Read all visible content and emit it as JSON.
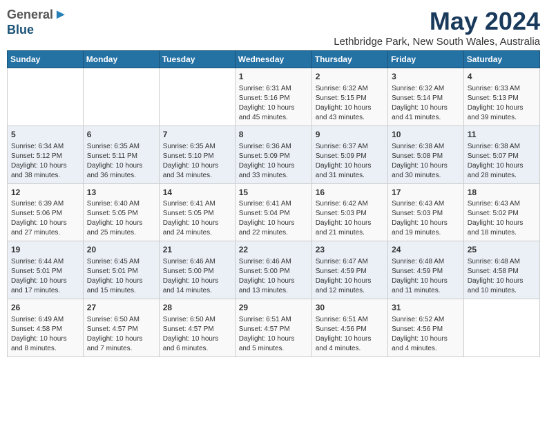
{
  "header": {
    "logo_general": "General",
    "logo_blue": "Blue",
    "month": "May 2024",
    "location": "Lethbridge Park, New South Wales, Australia"
  },
  "weekdays": [
    "Sunday",
    "Monday",
    "Tuesday",
    "Wednesday",
    "Thursday",
    "Friday",
    "Saturday"
  ],
  "weeks": [
    [
      {
        "day": "",
        "sunrise": "",
        "sunset": "",
        "daylight": ""
      },
      {
        "day": "",
        "sunrise": "",
        "sunset": "",
        "daylight": ""
      },
      {
        "day": "",
        "sunrise": "",
        "sunset": "",
        "daylight": ""
      },
      {
        "day": "1",
        "sunrise": "Sunrise: 6:31 AM",
        "sunset": "Sunset: 5:16 PM",
        "daylight": "Daylight: 10 hours and 45 minutes."
      },
      {
        "day": "2",
        "sunrise": "Sunrise: 6:32 AM",
        "sunset": "Sunset: 5:15 PM",
        "daylight": "Daylight: 10 hours and 43 minutes."
      },
      {
        "day": "3",
        "sunrise": "Sunrise: 6:32 AM",
        "sunset": "Sunset: 5:14 PM",
        "daylight": "Daylight: 10 hours and 41 minutes."
      },
      {
        "day": "4",
        "sunrise": "Sunrise: 6:33 AM",
        "sunset": "Sunset: 5:13 PM",
        "daylight": "Daylight: 10 hours and 39 minutes."
      }
    ],
    [
      {
        "day": "5",
        "sunrise": "Sunrise: 6:34 AM",
        "sunset": "Sunset: 5:12 PM",
        "daylight": "Daylight: 10 hours and 38 minutes."
      },
      {
        "day": "6",
        "sunrise": "Sunrise: 6:35 AM",
        "sunset": "Sunset: 5:11 PM",
        "daylight": "Daylight: 10 hours and 36 minutes."
      },
      {
        "day": "7",
        "sunrise": "Sunrise: 6:35 AM",
        "sunset": "Sunset: 5:10 PM",
        "daylight": "Daylight: 10 hours and 34 minutes."
      },
      {
        "day": "8",
        "sunrise": "Sunrise: 6:36 AM",
        "sunset": "Sunset: 5:09 PM",
        "daylight": "Daylight: 10 hours and 33 minutes."
      },
      {
        "day": "9",
        "sunrise": "Sunrise: 6:37 AM",
        "sunset": "Sunset: 5:09 PM",
        "daylight": "Daylight: 10 hours and 31 minutes."
      },
      {
        "day": "10",
        "sunrise": "Sunrise: 6:38 AM",
        "sunset": "Sunset: 5:08 PM",
        "daylight": "Daylight: 10 hours and 30 minutes."
      },
      {
        "day": "11",
        "sunrise": "Sunrise: 6:38 AM",
        "sunset": "Sunset: 5:07 PM",
        "daylight": "Daylight: 10 hours and 28 minutes."
      }
    ],
    [
      {
        "day": "12",
        "sunrise": "Sunrise: 6:39 AM",
        "sunset": "Sunset: 5:06 PM",
        "daylight": "Daylight: 10 hours and 27 minutes."
      },
      {
        "day": "13",
        "sunrise": "Sunrise: 6:40 AM",
        "sunset": "Sunset: 5:05 PM",
        "daylight": "Daylight: 10 hours and 25 minutes."
      },
      {
        "day": "14",
        "sunrise": "Sunrise: 6:41 AM",
        "sunset": "Sunset: 5:05 PM",
        "daylight": "Daylight: 10 hours and 24 minutes."
      },
      {
        "day": "15",
        "sunrise": "Sunrise: 6:41 AM",
        "sunset": "Sunset: 5:04 PM",
        "daylight": "Daylight: 10 hours and 22 minutes."
      },
      {
        "day": "16",
        "sunrise": "Sunrise: 6:42 AM",
        "sunset": "Sunset: 5:03 PM",
        "daylight": "Daylight: 10 hours and 21 minutes."
      },
      {
        "day": "17",
        "sunrise": "Sunrise: 6:43 AM",
        "sunset": "Sunset: 5:03 PM",
        "daylight": "Daylight: 10 hours and 19 minutes."
      },
      {
        "day": "18",
        "sunrise": "Sunrise: 6:43 AM",
        "sunset": "Sunset: 5:02 PM",
        "daylight": "Daylight: 10 hours and 18 minutes."
      }
    ],
    [
      {
        "day": "19",
        "sunrise": "Sunrise: 6:44 AM",
        "sunset": "Sunset: 5:01 PM",
        "daylight": "Daylight: 10 hours and 17 minutes."
      },
      {
        "day": "20",
        "sunrise": "Sunrise: 6:45 AM",
        "sunset": "Sunset: 5:01 PM",
        "daylight": "Daylight: 10 hours and 15 minutes."
      },
      {
        "day": "21",
        "sunrise": "Sunrise: 6:46 AM",
        "sunset": "Sunset: 5:00 PM",
        "daylight": "Daylight: 10 hours and 14 minutes."
      },
      {
        "day": "22",
        "sunrise": "Sunrise: 6:46 AM",
        "sunset": "Sunset: 5:00 PM",
        "daylight": "Daylight: 10 hours and 13 minutes."
      },
      {
        "day": "23",
        "sunrise": "Sunrise: 6:47 AM",
        "sunset": "Sunset: 4:59 PM",
        "daylight": "Daylight: 10 hours and 12 minutes."
      },
      {
        "day": "24",
        "sunrise": "Sunrise: 6:48 AM",
        "sunset": "Sunset: 4:59 PM",
        "daylight": "Daylight: 10 hours and 11 minutes."
      },
      {
        "day": "25",
        "sunrise": "Sunrise: 6:48 AM",
        "sunset": "Sunset: 4:58 PM",
        "daylight": "Daylight: 10 hours and 10 minutes."
      }
    ],
    [
      {
        "day": "26",
        "sunrise": "Sunrise: 6:49 AM",
        "sunset": "Sunset: 4:58 PM",
        "daylight": "Daylight: 10 hours and 8 minutes."
      },
      {
        "day": "27",
        "sunrise": "Sunrise: 6:50 AM",
        "sunset": "Sunset: 4:57 PM",
        "daylight": "Daylight: 10 hours and 7 minutes."
      },
      {
        "day": "28",
        "sunrise": "Sunrise: 6:50 AM",
        "sunset": "Sunset: 4:57 PM",
        "daylight": "Daylight: 10 hours and 6 minutes."
      },
      {
        "day": "29",
        "sunrise": "Sunrise: 6:51 AM",
        "sunset": "Sunset: 4:57 PM",
        "daylight": "Daylight: 10 hours and 5 minutes."
      },
      {
        "day": "30",
        "sunrise": "Sunrise: 6:51 AM",
        "sunset": "Sunset: 4:56 PM",
        "daylight": "Daylight: 10 hours and 4 minutes."
      },
      {
        "day": "31",
        "sunrise": "Sunrise: 6:52 AM",
        "sunset": "Sunset: 4:56 PM",
        "daylight": "Daylight: 10 hours and 4 minutes."
      },
      {
        "day": "",
        "sunrise": "",
        "sunset": "",
        "daylight": ""
      }
    ]
  ]
}
